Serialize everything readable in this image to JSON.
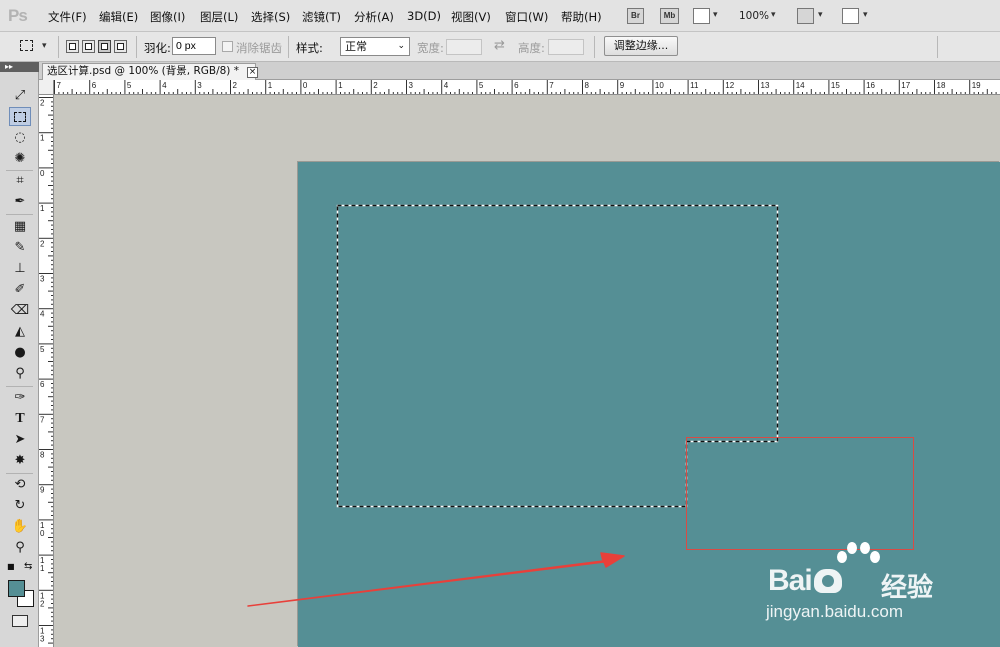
{
  "app": {
    "logo_text": "Ps"
  },
  "menubar": {
    "items": [
      "文件(F)",
      "编辑(E)",
      "图像(I)",
      "图层(L)",
      "选择(S)",
      "滤镜(T)",
      "分析(A)",
      "3D(D)",
      "视图(V)",
      "窗口(W)",
      "帮助(H)"
    ],
    "bridge_label": "Br",
    "minibridge_label": "Mb",
    "zoom": "100%"
  },
  "options": {
    "feather_label": "羽化:",
    "feather_value": "0 px",
    "antialias_label": "消除锯齿",
    "style_label": "样式:",
    "style_value": "正常",
    "width_label": "宽度:",
    "height_label": "高度:",
    "refine_edge_label": "调整边缘..."
  },
  "document": {
    "tab_title": "选区计算.psd @ 100% (背景, RGB/8) *",
    "canvas_color": "#558f95"
  },
  "ruler": {
    "horizontal": [
      "7",
      "6",
      "5",
      "4",
      "3",
      "2",
      "1",
      "0",
      "1",
      "2",
      "3",
      "4",
      "5",
      "6",
      "7",
      "8",
      "9",
      "10",
      "11",
      "12",
      "13",
      "14",
      "15",
      "16",
      "17",
      "18",
      "19"
    ],
    "vertical": [
      "2",
      "1",
      "0",
      "1",
      "2",
      "3",
      "4",
      "5",
      "6",
      "7",
      "8",
      "9",
      "10",
      "11",
      "12",
      "13"
    ]
  },
  "tools": [
    "move-tool",
    "rectangular-marquee-tool",
    "lasso-tool",
    "quick-selection-tool",
    "crop-tool",
    "eyedropper-tool",
    "spot-healing-tool",
    "brush-tool",
    "clone-stamp-tool",
    "history-brush-tool",
    "eraser-tool",
    "paint-bucket-tool",
    "blur-tool",
    "dodge-tool",
    "pen-tool",
    "type-tool",
    "path-selection-tool",
    "custom-shape-tool",
    "3d-rotate-tool",
    "3d-orbit-tool",
    "hand-tool",
    "zoom-tool"
  ],
  "colors": {
    "foreground": "#558f95",
    "background": "#ffffff",
    "arrow": "#e8403a",
    "selection_box": "#d94b45"
  },
  "watermark": {
    "brand": "Bai",
    "brand_suffix": "经验",
    "url": "jingyan.baidu.com"
  }
}
